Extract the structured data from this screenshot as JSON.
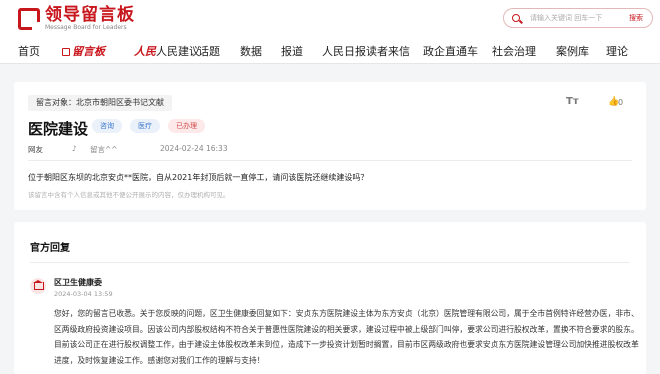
{
  "header": {
    "logo_cn": "领导留言板",
    "logo_en": "Message Board for Leaders",
    "search_placeholder": "请输入关键词 回车一下",
    "search_button": "搜索"
  },
  "nav": {
    "items": [
      "首页",
      "留言板",
      "人民建议",
      "话题",
      "数据",
      "报道",
      "人民日报读者来信",
      "政企直通车",
      "社会治理",
      "案例库",
      "理论"
    ],
    "brand_prefix": "人民"
  },
  "message": {
    "recipient": "留言对象：北京市朝阳区委书记文献",
    "title": "医院建设",
    "tags": [
      {
        "label": "咨询",
        "style": "blue"
      },
      {
        "label": "医疗",
        "style": "blue"
      },
      {
        "label": "已办理",
        "style": "red"
      }
    ],
    "author": "网友",
    "author_icon": "♪",
    "visibility": "留言^^",
    "datetime": "2024-02-24 16:33",
    "like_count": "0",
    "content": "位于朝阳区东坝的北京安贞**医院，自从2021年封顶后就一直停工，请问该医院还继续建设吗？",
    "notice": "该留言中含有个人信息或其他不便公开展示的内容，仅办理机构可见。"
  },
  "reply": {
    "heading": "官方回复",
    "org": "区卫生健康委",
    "datetime": "2024-03-04 13:59",
    "body": "您好，您的留言已收悉。关于您反映的问题，区卫生健康委回复如下：安贞东方医院建设主体为东方安贞（北京）医院管理有限公司，属于全市首例特许经营办医，非市、区两级政府投资建设项目。因该公司内部股权结构不符合关于普惠性医院建设的相关要求，建设过程中被上级部门叫停，要求公司进行股权改革，置换不符合要求的股东。目前该公司正在进行股权调整工作，由于建设主体股权改革未到位，造成下一步投资计划暂时搁置，目前市区两级政府也要求安贞东方医院建设管理公司加快推进股权改革进度，及时恢复建设工作。感谢您对我们工作的理解与支持！"
  },
  "colors": {
    "brand_red": "#c8161d",
    "tag_blue": "#3a78c9",
    "tag_red": "#d24a4a"
  }
}
